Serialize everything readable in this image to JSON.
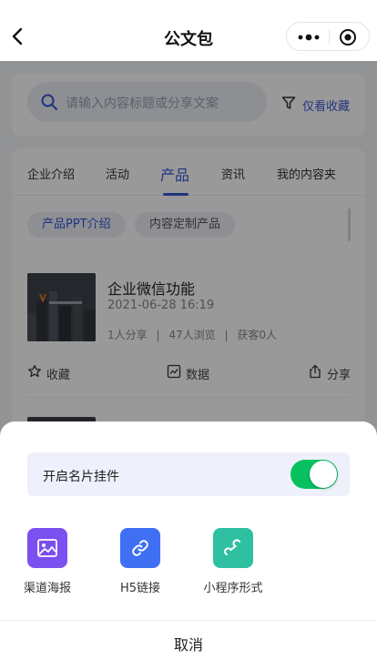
{
  "nav": {
    "title": "公文包"
  },
  "search": {
    "placeholder": "请输入内容标题或分享文案",
    "filter_label": "仅看收藏"
  },
  "tabs": [
    {
      "label": "企业介绍",
      "active": false
    },
    {
      "label": "活动",
      "active": false
    },
    {
      "label": "产品",
      "active": true
    },
    {
      "label": "资讯",
      "active": false
    },
    {
      "label": "我的内容夹",
      "active": false
    }
  ],
  "chips": [
    {
      "label": "产品PPT介绍",
      "active": true
    },
    {
      "label": "内容定制产品",
      "active": false
    }
  ],
  "item": {
    "name": "企业微信功能",
    "date": "2021-06-28 16:19",
    "shares": "1人分享",
    "views": "47人浏览",
    "leads": "获客0人",
    "separator": "|",
    "actions": {
      "favorite": "收藏",
      "data": "数据",
      "share": "分享"
    }
  },
  "sheet": {
    "toggle_label": "开启名片挂件",
    "toggle_on": true,
    "options": [
      {
        "label": "渠道海报",
        "icon": "image-icon",
        "color": "#7b4ff0"
      },
      {
        "label": "H5链接",
        "icon": "link-icon",
        "color": "#3f6ff2"
      },
      {
        "label": "小程序形式",
        "icon": "mini-program-icon",
        "color": "#2fc0a1"
      }
    ],
    "cancel_label": "取消"
  },
  "colors": {
    "accent": "#3a55d8",
    "switch_on": "#07c160"
  }
}
